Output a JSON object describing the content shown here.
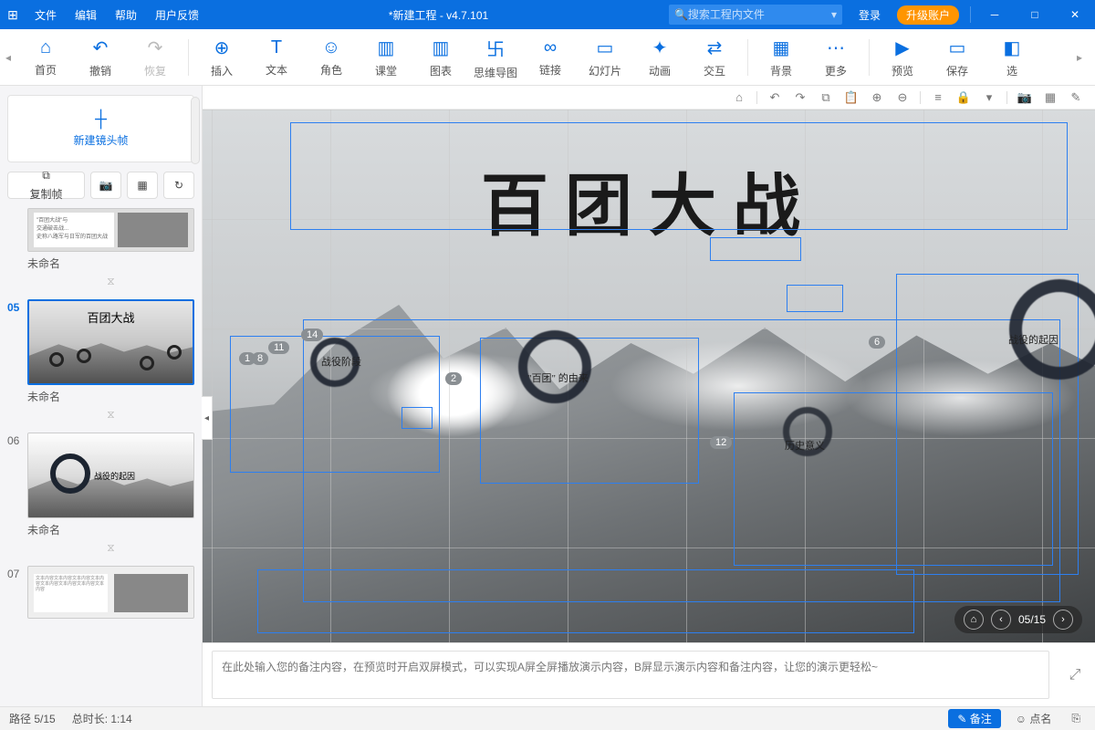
{
  "titlebar": {
    "menus": [
      "文件",
      "编辑",
      "帮助",
      "用户反馈"
    ],
    "title": "*新建工程 - v4.7.101",
    "search_placeholder": "搜索工程内文件",
    "login": "登录",
    "upgrade": "升级账户"
  },
  "ribbon": {
    "items": [
      {
        "label": "首页",
        "icon": "⌂"
      },
      {
        "label": "撤销",
        "icon": "↶"
      },
      {
        "label": "恢复",
        "icon": "↷",
        "disabled": true
      },
      {
        "sep": true
      },
      {
        "label": "插入",
        "icon": "⊕"
      },
      {
        "label": "文本",
        "icon": "T"
      },
      {
        "label": "角色",
        "icon": "☺"
      },
      {
        "label": "课堂",
        "icon": "▥"
      },
      {
        "label": "图表",
        "icon": "▥"
      },
      {
        "label": "思维导图",
        "icon": "卐"
      },
      {
        "label": "链接",
        "icon": "∞"
      },
      {
        "label": "幻灯片",
        "icon": "▭"
      },
      {
        "label": "动画",
        "icon": "✦"
      },
      {
        "label": "交互",
        "icon": "⇄"
      },
      {
        "sep": true
      },
      {
        "label": "背景",
        "icon": "▦"
      },
      {
        "label": "更多",
        "icon": "⋯"
      },
      {
        "sep": true
      },
      {
        "label": "预览",
        "icon": "▶"
      },
      {
        "label": "保存",
        "icon": "▭"
      },
      {
        "label": "选",
        "icon": "◧"
      }
    ]
  },
  "sidebar": {
    "new_frame": "新建镜头帧",
    "copy_frame": "复制帧",
    "thumbs": [
      {
        "num": "",
        "label": "未命名"
      },
      {
        "num": "05",
        "label": "未命名",
        "active": true,
        "title": "百团大战"
      },
      {
        "num": "06",
        "label": "未命名",
        "caption": "战役的起因"
      },
      {
        "num": "07",
        "label": ""
      }
    ]
  },
  "canvas": {
    "main_title": "百团大战",
    "labels": {
      "c1": "战役阶段",
      "c2": "\"百团\" 的由来",
      "c3": "战役的起因",
      "c4": "历史意义"
    },
    "badges": {
      "b1": "1",
      "b2": "8",
      "b3": "11",
      "b4": "14",
      "b5": "2",
      "b6": "12",
      "b7": "6"
    },
    "bottom_nav": "05/15"
  },
  "notes": {
    "placeholder": "在此处输入您的备注内容，在预览时开启双屏模式，可以实现A屏全屏播放演示内容，B屏显示演示内容和备注内容，让您的演示更轻松~"
  },
  "statusbar": {
    "path": "路径 5/15",
    "duration": "总时长: 1:14",
    "mode_notes": "备注",
    "mode_dots": "点名"
  }
}
